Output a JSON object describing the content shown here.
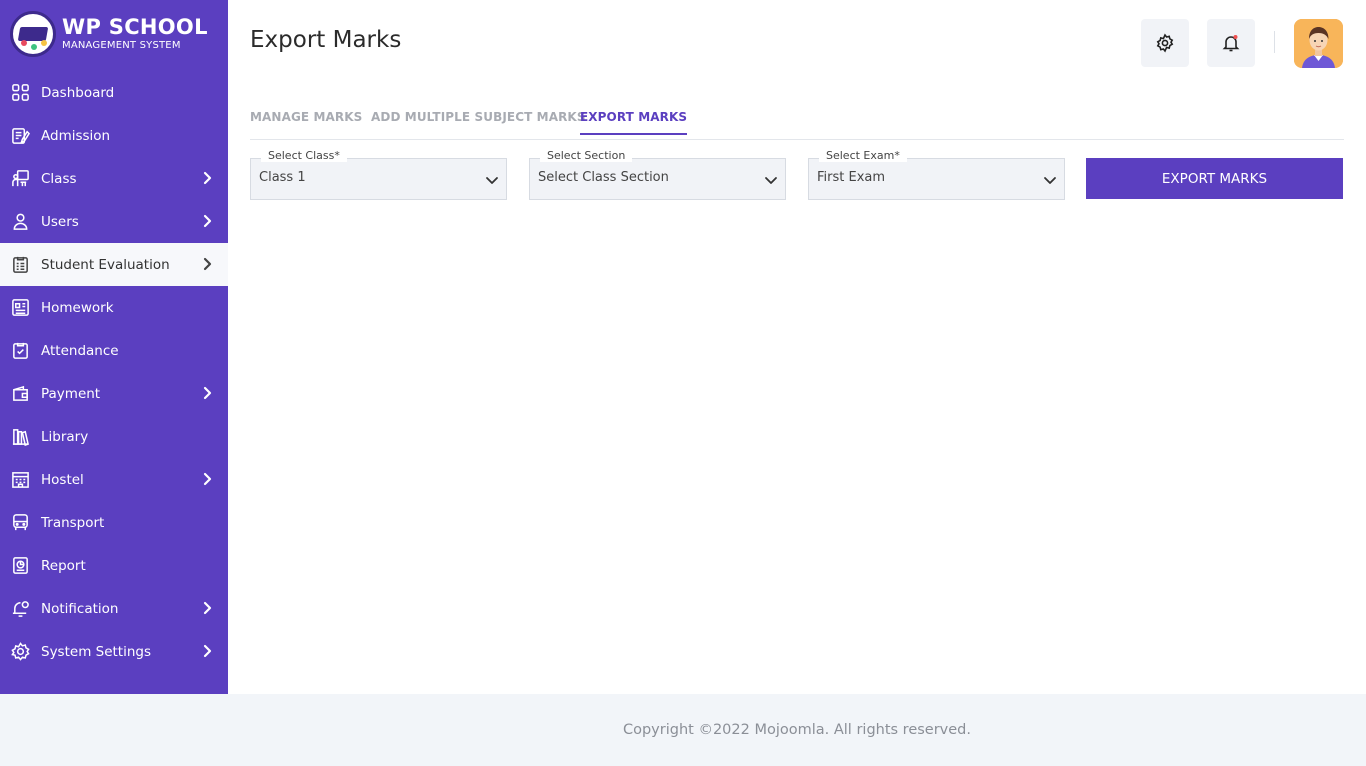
{
  "brand": {
    "title": "WP SCHOOL",
    "subtitle": "MANAGEMENT SYSTEM"
  },
  "sidebar": {
    "items": [
      {
        "label": "Dashboard",
        "icon": "dashboard-icon",
        "has_submenu": false,
        "active": false
      },
      {
        "label": "Admission",
        "icon": "admission-icon",
        "has_submenu": false,
        "active": false
      },
      {
        "label": "Class",
        "icon": "class-icon",
        "has_submenu": true,
        "active": false
      },
      {
        "label": "Users",
        "icon": "user-icon",
        "has_submenu": true,
        "active": false
      },
      {
        "label": "Student Evaluation",
        "icon": "evaluation-icon",
        "has_submenu": true,
        "active": true
      },
      {
        "label": "Homework",
        "icon": "homework-icon",
        "has_submenu": false,
        "active": false
      },
      {
        "label": "Attendance",
        "icon": "attendance-icon",
        "has_submenu": false,
        "active": false
      },
      {
        "label": "Payment",
        "icon": "wallet-icon",
        "has_submenu": true,
        "active": false
      },
      {
        "label": "Library",
        "icon": "library-icon",
        "has_submenu": false,
        "active": false
      },
      {
        "label": "Hostel",
        "icon": "hostel-icon",
        "has_submenu": true,
        "active": false
      },
      {
        "label": "Transport",
        "icon": "bus-icon",
        "has_submenu": false,
        "active": false
      },
      {
        "label": "Report",
        "icon": "report-icon",
        "has_submenu": false,
        "active": false
      },
      {
        "label": "Notification",
        "icon": "notification-icon",
        "has_submenu": true,
        "active": false
      },
      {
        "label": "System Settings",
        "icon": "settings-icon",
        "has_submenu": true,
        "active": false
      }
    ]
  },
  "header": {
    "title": "Export Marks"
  },
  "tabs": [
    {
      "label": "MANAGE MARKS",
      "active": false
    },
    {
      "label": "ADD MULTIPLE SUBJECT MARKS",
      "active": false
    },
    {
      "label": "EXPORT MARKS",
      "active": true
    }
  ],
  "form": {
    "class_select": {
      "label": "Select Class*",
      "value": "Class 1"
    },
    "section_select": {
      "label": "Select Section",
      "value": "Select Class Section"
    },
    "exam_select": {
      "label": "Select Exam*",
      "value": "First Exam"
    },
    "export_button": "EXPORT MARKS"
  },
  "footer": {
    "copyright": "Copyright ©2022 Mojoomla. All rights reserved."
  },
  "colors": {
    "primary": "#5b3fc0",
    "notification_dot": "#f05252",
    "avatar_bg": "#f8b55a"
  }
}
